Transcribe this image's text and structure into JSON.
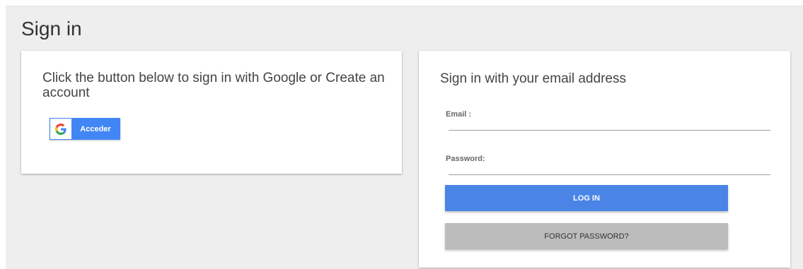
{
  "page": {
    "title": "Sign in"
  },
  "google_card": {
    "heading": "Click the button below to sign in with Google or Create an account",
    "button_label": "Acceder",
    "icon": "google-g-icon"
  },
  "email_card": {
    "heading": "Sign in with your email address",
    "email_label": "Email :",
    "email_value": "",
    "password_label": "Password:",
    "password_value": "",
    "login_label": "LOG IN",
    "forgot_label": "FORGOT PASSWORD?"
  },
  "colors": {
    "background": "#eeeeee",
    "primary": "#4a84e6",
    "secondary": "#bcbcbc",
    "google_blue": "#4285f4"
  }
}
